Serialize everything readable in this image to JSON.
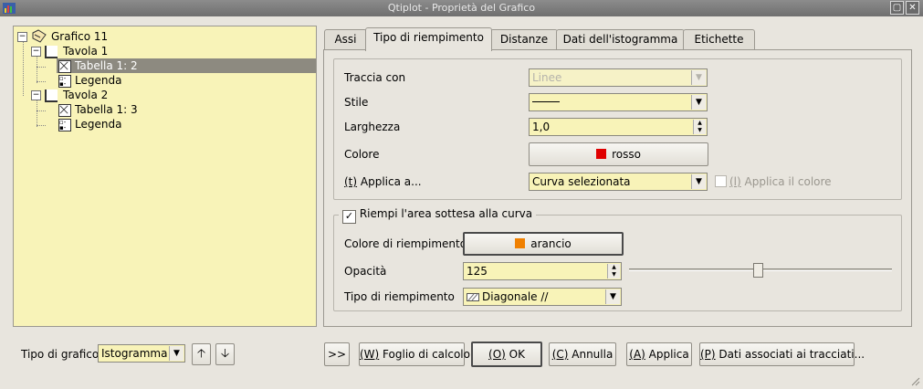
{
  "window": {
    "title": "Qtiplot - Proprietà del Grafico"
  },
  "tree": {
    "items": [
      {
        "label": "Grafico 11",
        "level": 0,
        "icon": "graph-folder-icon",
        "selected": false
      },
      {
        "label": "Tavola 1",
        "level": 1,
        "icon": "layer-icon",
        "selected": false
      },
      {
        "label": "Tabella 1: 2",
        "level": 2,
        "icon": "curve-icon",
        "selected": true
      },
      {
        "label": "Legenda",
        "level": 2,
        "icon": "legend-icon",
        "selected": false
      },
      {
        "label": "Tavola 2",
        "level": 1,
        "icon": "layer-icon",
        "selected": false
      },
      {
        "label": "Tabella 1: 3",
        "level": 2,
        "icon": "curve-icon",
        "selected": false
      },
      {
        "label": "Legenda",
        "level": 2,
        "icon": "legend-icon",
        "selected": false
      }
    ]
  },
  "tabs": [
    "Assi",
    "Tipo di riempimento",
    "Distanze",
    "Dati dell'istogramma",
    "Etichette"
  ],
  "active_tab": 1,
  "form": {
    "draw_with_label": "Traccia con",
    "draw_with_value": "Linee",
    "style_label": "Stile",
    "width_label": "Larghezza",
    "width_value": "1,0",
    "color_label": "Colore",
    "color_value": "rosso",
    "color_hex": "#e00000",
    "apply_to_label_prefix": "(t)",
    "apply_to_label_rest": " Applica a...",
    "apply_to_value": "Curva selezionata",
    "apply_color_prefix": "(l)",
    "apply_color_rest": " Applica il colore"
  },
  "fill": {
    "group_label": "Riempi l'area sottesa alla curva",
    "checked": true,
    "fill_color_label": "Colore di riempimento",
    "fill_color_value": "arancio",
    "fill_color_hex": "#f08000",
    "opacity_label": "Opacità",
    "opacity_value": "125",
    "opacity_max": 255,
    "pattern_label": "Tipo di riempimento",
    "pattern_value": "Diagonale //"
  },
  "bottom": {
    "plot_type_label": "Tipo di grafico",
    "plot_type_value": "Istogramma",
    "expand_label": ">>",
    "worksheet_prefix": "(W)",
    "worksheet_rest": " Foglio di calcolo",
    "ok_prefix": "(O)",
    "ok_rest": " OK",
    "cancel_prefix": "(C)",
    "cancel_rest": " Annulla",
    "apply_prefix": "(A)",
    "apply_rest": " Applica",
    "data_prefix": "(P)",
    "data_rest": " Dati associati ai tracciati..."
  }
}
